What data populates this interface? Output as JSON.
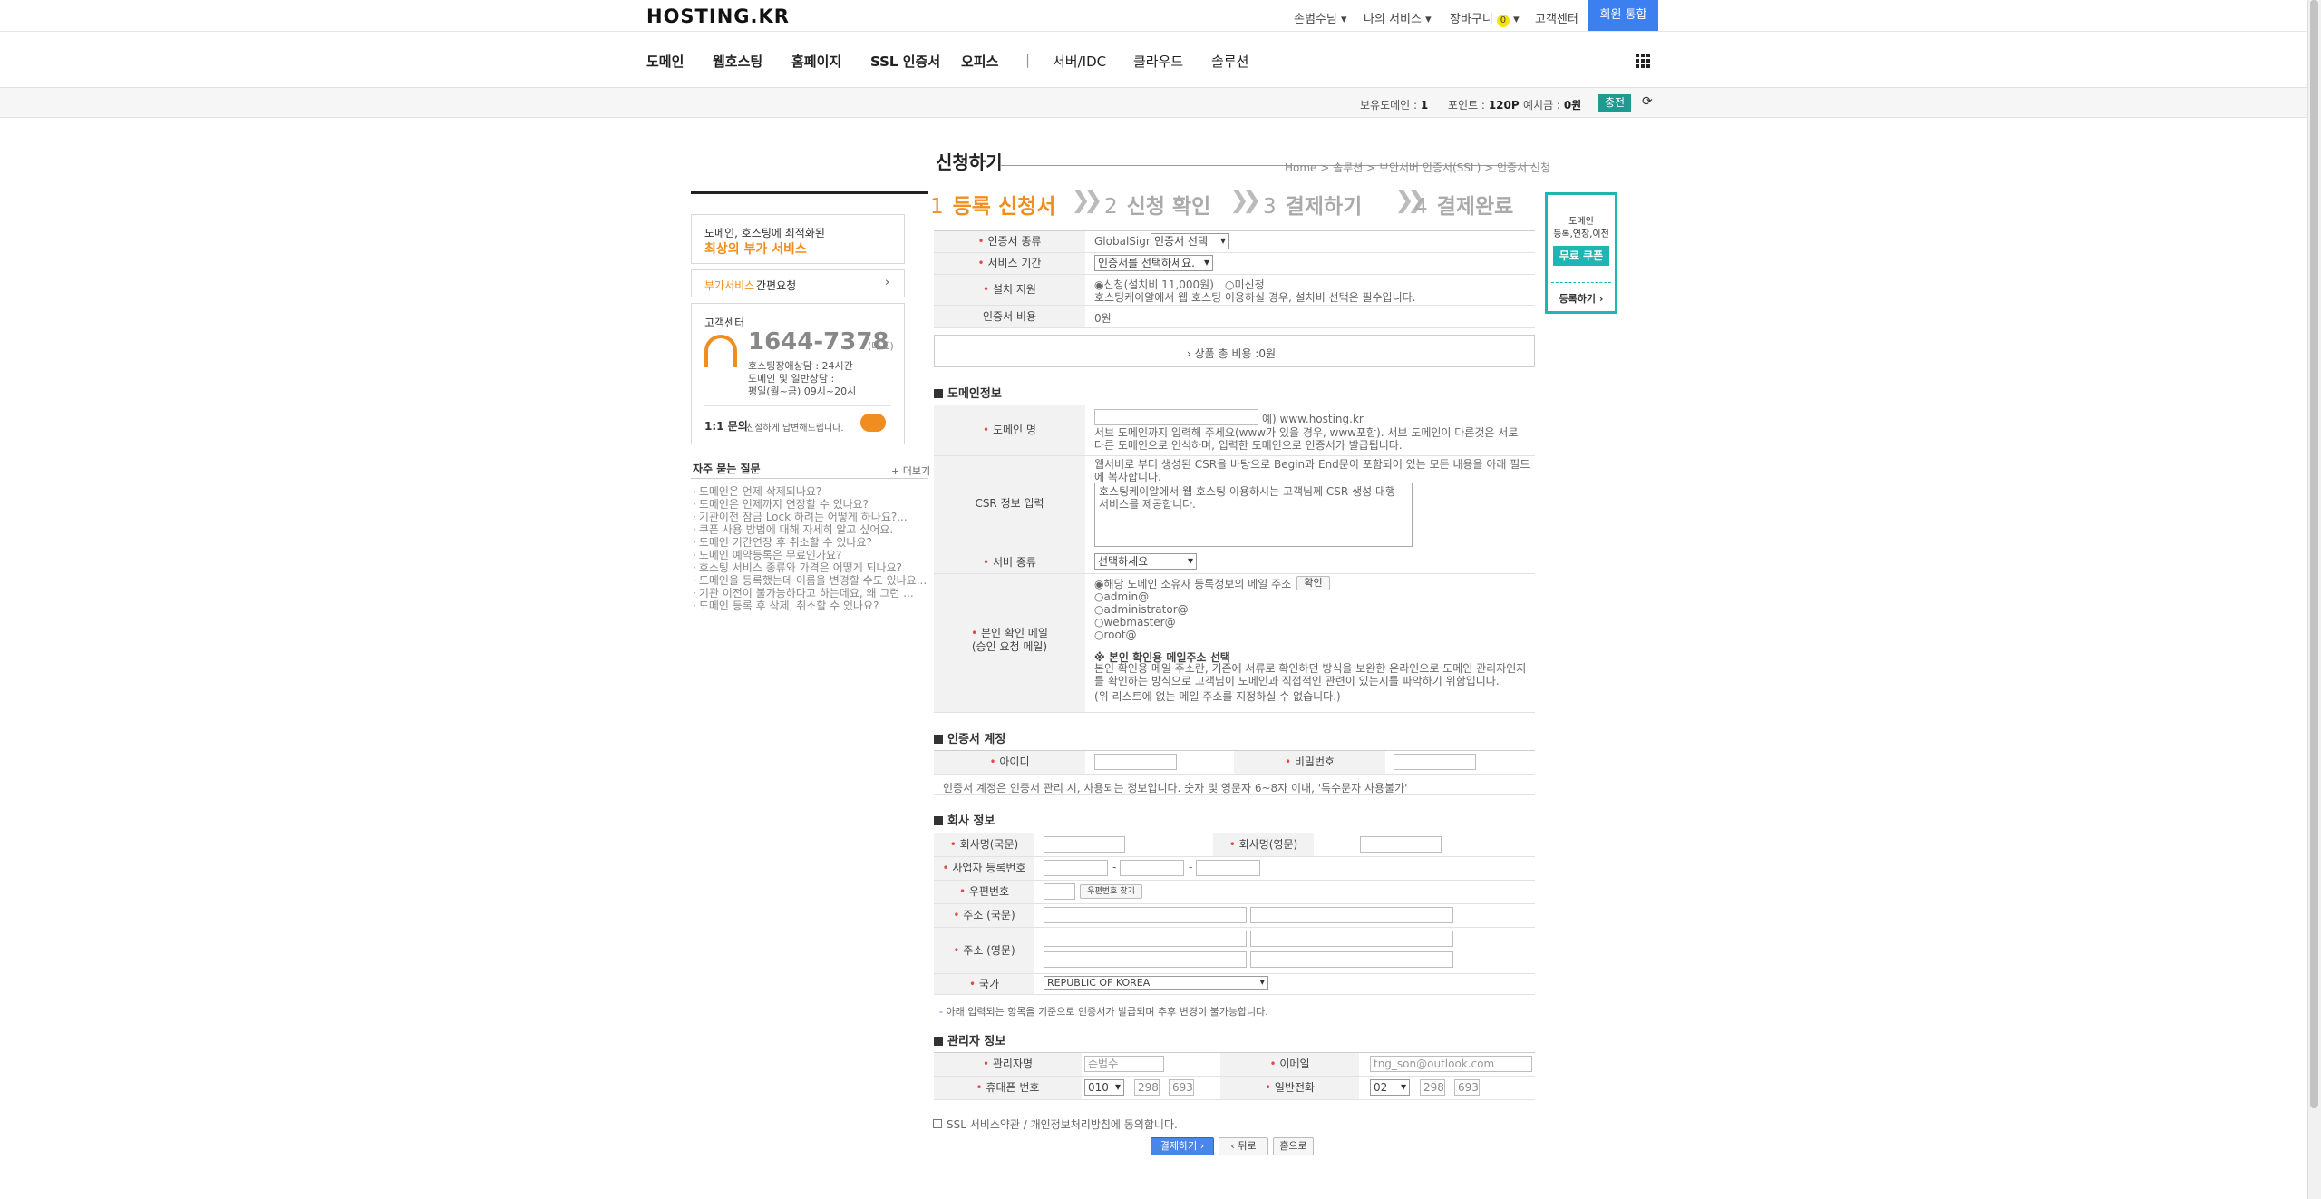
{
  "header": {
    "logo": "HOSTING.KR",
    "links": [
      "손범수님",
      "나의 서비스",
      "장바구니",
      "고객센터"
    ],
    "cart_count": "0",
    "join": "회원 통합"
  },
  "nav": {
    "items": [
      "도메인",
      "웹호스팅",
      "홈페이지",
      "SSL 인증서",
      "오피스",
      "|",
      "서버/IDC",
      "클라우드",
      "솔루션"
    ]
  },
  "status": {
    "domains_label": "보유도메인 :",
    "domains": "1",
    "points_label": "포인트 :",
    "points": "120P",
    "deposit_label": "예치금 :",
    "deposit": "0원",
    "charge": "충전"
  },
  "left": {
    "promo_line1": "도메인, 호스팅에 최적화된",
    "promo_line2": "최상의 부가 서비스",
    "quote_prefix": "부가서비스",
    "quote_suffix": "간편요청",
    "cs_title": "고객센터",
    "cs_phone": "1644-7378",
    "cs_rep": "(대표)",
    "cs_l1": "호스팅장애상담 : 24시간",
    "cs_l2": "도메인 및 일반상담 :",
    "cs_l3": "평일(월~금) 09시~20시",
    "inq_title": "1:1 문의",
    "inq_desc": "친절하게 답변해드립니다.",
    "faq_title": "자주 묻는 질문",
    "faq_more": "+ 더보기",
    "faq": [
      "도메인은 언제 삭제되나요?",
      "도메인은 언제까지 연장할 수 있나요?",
      "기관이전 잠금 Lock 하려는 어떻게 하나요?...",
      "쿠폰 사용 방법에 대해 자세히 알고 싶어요.",
      "도메인 기간연장 후 취소할 수 있나요?",
      "도메인 예약등록은 무료인가요?",
      "호스팅 서비스 종류와 가격은 어떻게 되나요?",
      "도메인을 등록했는데 이름을 변경할 수도 있나요...",
      "기관 이전이 불가능하다고 하는데요, 왜 그런 ...",
      "도메인 등록 후 삭제, 취소할 수 있나요?"
    ]
  },
  "page": {
    "title": "신청하기",
    "breadcrumb": "Home > 솔루션 > 보안서버 인증서(SSL) > 인증서 신청",
    "steps": [
      {
        "num": "1",
        "label": "등록 신청서"
      },
      {
        "num": "2",
        "label": "신청 확인"
      },
      {
        "num": "3",
        "label": "결제하기"
      },
      {
        "num": "4",
        "label": "결제완료"
      }
    ]
  },
  "form": {
    "cert_type_label": "인증서 종류",
    "cert_type_brand": "GlobalSign",
    "cert_type_select": "인증서 선택",
    "period_label": "서비스 기간",
    "period_select": "인증서를 선택하세요.",
    "install_label": "설치 지원",
    "install_opt1": "신청(설치비 11,000원)",
    "install_opt2": "미신청",
    "install_note": "호스팅케이알에서 웹 호스팅 이용하실 경우, 설치비 선택은 필수입니다.",
    "cost_label": "인증서 비용",
    "cost_value": "0원",
    "total_label": "상품 총 비용 :",
    "total_value": "0원",
    "domain_section": "도메인정보",
    "domain_label": "도메인 명",
    "domain_example": "예) www.hosting.kr",
    "domain_note": "서브 도메인까지 입력해 주세요(www가 있을 경우, www포함). 서브 도메인이 다른것은 서로 다른 도메인으로 인식하며, 입력한 도메인으로 인증서가 발급됩니다.",
    "csr_label": "CSR 정보 입력",
    "csr_note": "웹서버로 부터 생성된 CSR을 바탕으로 Begin과 End문이 포함되어 있는 모든 내용을 아래 필드에 복사합니다.",
    "csr_placeholder": "호스팅케이알에서 웹 호스팅 이용하시는 고객님께 CSR 생성 대행 서비스를 제공합니다.",
    "server_label": "서버 종류",
    "server_select": "선택하세요",
    "email_label_1": "본인 확인 메일",
    "email_label_2": "(승인 요청 메일)",
    "email_opts": [
      "해당 도메인 소유자 등록정보의 메일 주소",
      "admin@",
      "administrator@",
      "webmaster@",
      "root@"
    ],
    "email_check": "확인",
    "email_note_title": "※ 본인 확인용 메일주소 선택",
    "email_note_1": "본인 확인용 메일 주소란, 기존에 서류로 확인하던 방식을 보완한 온라인으로 도메인 관리자인지를 확인하는 방식으로 고객님이 도메인과 직접적인 관련이 있는지를 파악하기 위함입니다.",
    "email_note_2": "(위 리스트에 없는 메일 주소를 지정하실 수 없습니다.)",
    "account_section": "인증서 계정",
    "id_label": "아이디",
    "pw_label": "비밀번호",
    "account_note": "인증서 계정은 인증서 관리 시, 사용되는 정보입니다. 숫자 및 영문자 6~8자 이내, '특수문자 사용불가'",
    "company_section": "회사 정보",
    "company_kr": "회사명(국문)",
    "company_en": "회사명(영문)",
    "biz_no": "사업자 등록번호",
    "zip": "우편번호",
    "zip_btn": "우편번호 찾기",
    "addr_kr": "주소 (국문)",
    "addr_en": "주소 (영문)",
    "country": "국가",
    "country_value": "REPUBLIC OF KOREA",
    "company_note": "아래 입력되는 항목을 기준으로 인증서가 발급되며 추후 변경이 불가능합니다.",
    "admin_section": "관리자 정보",
    "admin_name": "관리자명",
    "admin_name_value": "손범수",
    "admin_email": "이메일",
    "admin_email_value": "tng_son@outlook.com",
    "mobile": "휴대폰 번호",
    "mobile_1": "010",
    "mobile_2": "298",
    "mobile_3": "693",
    "phone": "일반전화",
    "phone_1": "02",
    "phone_2": "298",
    "phone_3": "693",
    "agree": "SSL 서비스약관 / 개인정보처리방침에 동의합니다.",
    "pay_btn": "결제하기",
    "back_btn": "뒤로",
    "home_btn": "홈으로"
  },
  "coupon": {
    "l1": "도메인",
    "l2": "등록,연장,이전",
    "badge": "무료 쿠폰",
    "btn": "등록하기"
  }
}
